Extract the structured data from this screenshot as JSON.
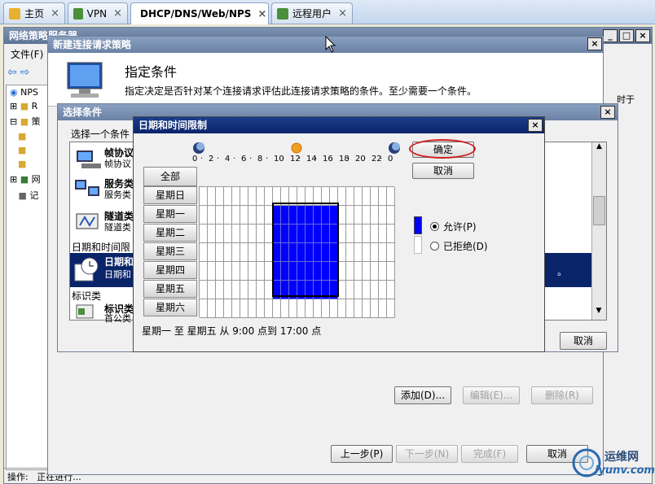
{
  "tabs": [
    {
      "label": "主页",
      "close": "×"
    },
    {
      "label": "VPN",
      "close": "×"
    },
    {
      "label": "DHCP/DNS/Web/NPS",
      "close": "×"
    },
    {
      "label": "远程用户",
      "close": "×"
    }
  ],
  "nps_window": {
    "title": "网络策略服务器",
    "menu_file": "文件(F)",
    "tree": [
      "NPS",
      "R",
      "策",
      "网",
      "记"
    ],
    "right_text": "时于",
    "status_label": "操作:",
    "status_text": "正在进行..."
  },
  "wizard": {
    "title": "新建连接请求策略",
    "heading": "指定条件",
    "description": "指定决定是否针对某个连接请求评估此连接请求策略的条件。至少需要一个条件。",
    "add_label": "添加(D)...",
    "edit_label": "编辑(E)...",
    "delete_label": "删除(R)",
    "prev_label": "上一步(P)",
    "next_label": "下一步(N)",
    "finish_label": "完成(F)",
    "cancel_label": "取消"
  },
  "select_condition": {
    "title": "选择条件",
    "prompt": "选择一个条件",
    "items": [
      {
        "name": "帧协议",
        "desc": "帧协议"
      },
      {
        "name": "服务类",
        "desc": "服务类"
      },
      {
        "name": "隧道类",
        "desc": "隧道类"
      }
    ],
    "group_datetime": "日期和时间限",
    "selected_item": "日期和",
    "selected_desc": "日期和",
    "selected_tail": "。",
    "group_identity": "标识类",
    "identity_item": "标识类",
    "identity_desc": "首公类",
    "cancel_label": "取消"
  },
  "datetime_dialog": {
    "title": "日期和时间限制",
    "close": "×",
    "hour_labels": [
      "0",
      "2",
      "4",
      "6",
      "8",
      "10",
      "12",
      "14",
      "16",
      "18",
      "20",
      "22",
      "0"
    ],
    "all_label": "全部",
    "days": [
      "星期日",
      "星期一",
      "星期二",
      "星期三",
      "星期四",
      "星期五",
      "星期六"
    ],
    "ok_label": "确定",
    "cancel_label": "取消",
    "permit_label": "允许(P)",
    "deny_label": "已拒绝(D)",
    "permit_selected": true,
    "summary": "星期一 至 星期五 从 9:00 点到 17:00 点",
    "permitted_days": [
      1,
      2,
      3,
      4,
      5
    ],
    "permitted_hours_start": 9,
    "permitted_hours_end": 17,
    "permit_color": "#0000ff"
  },
  "watermark": {
    "text": "运维网",
    "url": "iyunv.com"
  }
}
